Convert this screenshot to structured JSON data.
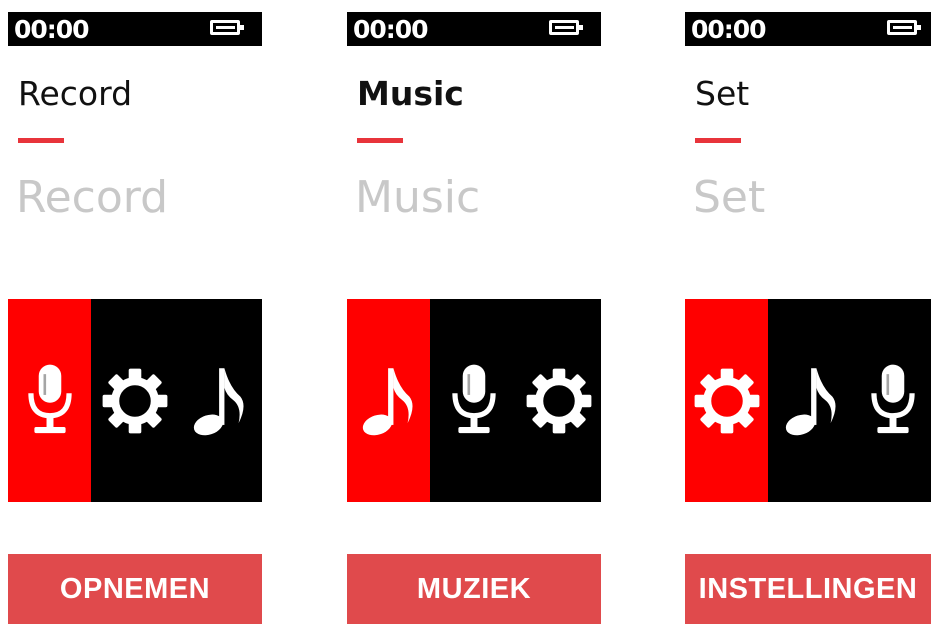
{
  "status_time": "00:00",
  "panels": [
    {
      "title": "Record",
      "subtitle": "Record",
      "caption": "OPNEMEN",
      "icons": [
        "microphone-icon",
        "gear-icon",
        "music-note-icon"
      ]
    },
    {
      "title": "Music",
      "subtitle": "Music",
      "caption": "MUZIEK",
      "icons": [
        "music-note-icon",
        "microphone-icon",
        "gear-icon"
      ]
    },
    {
      "title": "Set",
      "subtitle": "Set",
      "caption": "INSTELLINGEN",
      "icons": [
        "gear-icon",
        "music-note-icon",
        "microphone-icon"
      ]
    }
  ],
  "colors": {
    "accent": "#ff0000",
    "caption_bg": "#e04a4c",
    "dash": "#e8343b",
    "subtitle_gray": "#c8c8c8",
    "bar_black": "#000000"
  }
}
